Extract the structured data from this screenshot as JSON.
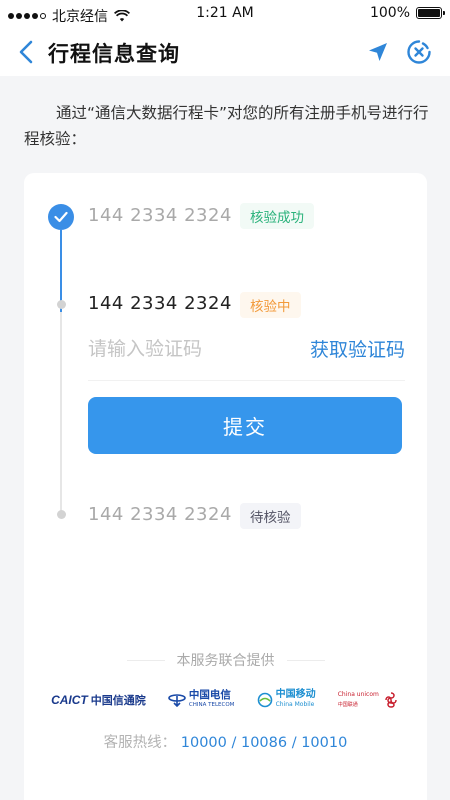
{
  "status_bar": {
    "carrier": "北京经信",
    "time": "1:21 AM",
    "battery": "100%"
  },
  "nav": {
    "title": "行程信息查询",
    "icons": [
      "back-chevron-icon",
      "location-arrow-icon",
      "close-circle-icon"
    ]
  },
  "intro": {
    "text": "通过“通信大数据行程卡”对您的所有注册手机号进行行程核验："
  },
  "timeline": [
    {
      "phone": "144 2334 2324",
      "status": "核验成功",
      "state": "success"
    },
    {
      "phone": "144 2334 2324",
      "status": "核验中",
      "state": "pending"
    },
    {
      "phone": "144 2334 2324",
      "status": "待核验",
      "state": "waiting"
    }
  ],
  "verify": {
    "placeholder": "请输入验证码",
    "get_code_label": "获取验证码",
    "submit_label": "提交"
  },
  "footer": {
    "provided_by": "本服务联合提供",
    "logos": [
      {
        "mark": "CAICT",
        "cn": "中国信通院"
      },
      {
        "cn": "中国电信",
        "en": "CHINA TELECOM"
      },
      {
        "cn": "中国移动",
        "en": "China Mobile"
      },
      {
        "en": "China unicom",
        "cn": "中国联通"
      }
    ],
    "hotline_label": "客服热线：",
    "hotline_numbers": "10000 / 10086 / 10010"
  },
  "colors": {
    "accent": "#3696ec",
    "success": "#2ab27b",
    "pending": "#f29a3a",
    "link": "#2f86d8"
  }
}
